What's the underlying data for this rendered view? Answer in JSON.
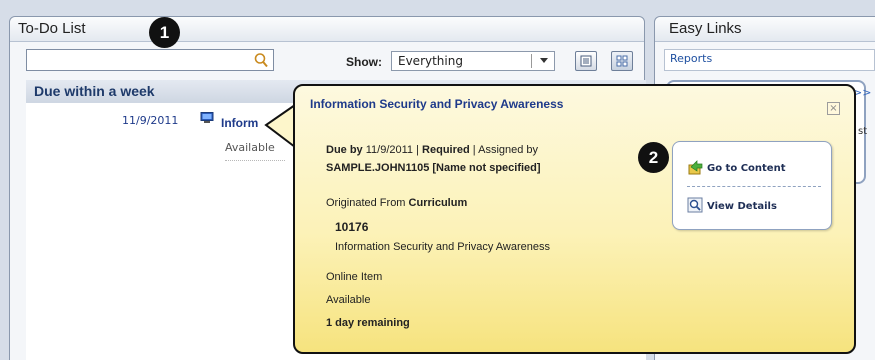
{
  "todo": {
    "title": "To-Do List",
    "search": {
      "placeholder": ""
    },
    "show_label": "Show:",
    "show_value": "Everything",
    "section_title": "Due within a week",
    "row": {
      "date": "11/9/2011",
      "title_fragment": "Inform",
      "status": "Available"
    }
  },
  "easy_links": {
    "title": "Easy Links",
    "reports": "Reports",
    "arrow": ">>",
    "fragment": "st"
  },
  "callouts": {
    "one": "1",
    "two": "2"
  },
  "popup": {
    "title": "Information Security and Privacy Awareness",
    "close_glyph": "×",
    "due_label": "Due by",
    "due_date": "11/9/2011",
    "sep": "|",
    "required": "Required",
    "assigned_by": "Assigned by",
    "assignee": "SAMPLE.JOHN1105 [Name not specified]",
    "originated_label": "Originated From",
    "originated_value": "Curriculum",
    "item_id": "10176",
    "item_name": "Information Security and Privacy Awareness",
    "item_type": "Online Item",
    "availability": "Available",
    "remaining": "1 day remaining",
    "actions": {
      "go_to_content": "Go to Content",
      "view_details": "View Details"
    }
  },
  "colors": {
    "popup_bg": "#fcf2b8",
    "link": "#1e3a8a",
    "callout": "#111111"
  }
}
